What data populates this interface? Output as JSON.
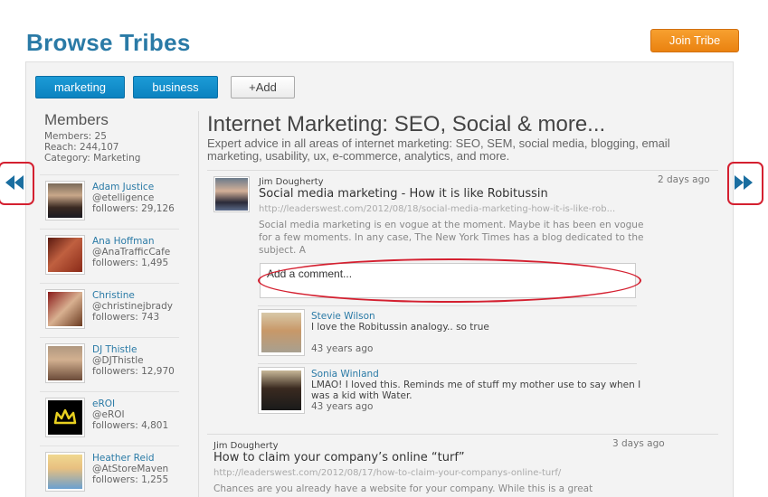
{
  "header": {
    "title": "Browse Tribes",
    "join_label": "Join Tribe"
  },
  "tags": [
    {
      "label": "marketing"
    },
    {
      "label": "business"
    }
  ],
  "add_label": "+Add",
  "members": {
    "title": "Members",
    "count": "Members: 25",
    "reach": "Reach: 244,107",
    "category": "Category: Marketing",
    "list": [
      {
        "name": "Adam Justice",
        "handle": "@etelligence",
        "followers": "followers: 29,126"
      },
      {
        "name": "Ana Hoffman",
        "handle": "@AnaTrafficCafe",
        "followers": "followers: 1,495"
      },
      {
        "name": "Christine",
        "handle": "@christinejbrady",
        "followers": "followers: 743"
      },
      {
        "name": "DJ Thistle",
        "handle": "@DJThistle",
        "followers": "followers: 12,970"
      },
      {
        "name": "eROI",
        "handle": "@eROI",
        "followers": "followers: 4,801"
      },
      {
        "name": "Heather Reid",
        "handle": "@AtStoreMaven",
        "followers": "followers: 1,255"
      }
    ]
  },
  "tribe": {
    "title": "Internet Marketing: SEO, Social & more...",
    "description": "Expert advice in all areas of internet marketing: SEO, SEM, social media, blogging, email marketing, usability, ux, e-commerce, analytics, and more."
  },
  "posts": [
    {
      "author": "Jim Dougherty",
      "time": "2 days ago",
      "title": "Social media marketing - How it is like Robitussin",
      "url": "http://leaderswest.com/2012/08/18/social-media-marketing-how-it-is-like-rob...",
      "excerpt": "Social media marketing is en vogue at the moment.  Maybe it has been en vogue for a few moments.  In any case, The New York Times has a blog dedicated to the subject. A",
      "comment_placeholder": "Add a comment...",
      "comments": [
        {
          "name": "Stevie Wilson",
          "text": "I love the Robitussin analogy.. so true",
          "time": "43 years ago"
        },
        {
          "name": "Sonia Winland",
          "text": "LMAO! I loved this. Reminds me of stuff my mother use to say when I was a kid with Water.",
          "time": "43 years ago"
        }
      ]
    },
    {
      "author": "Jim Dougherty",
      "time": "3 days ago",
      "title": "How to claim your company’s online “turf”",
      "url": "http://leaderswest.com/2012/08/17/how-to-claim-your-companys-online-turf/",
      "excerpt": "Chances are you already have a website for your company. While this is a great"
    }
  ],
  "colors": {
    "brand_blue": "#2a7aa6",
    "tag_blue": "#0b82c0",
    "join_orange": "#ea8210",
    "highlight_red": "#d42030"
  },
  "icons": {
    "prev": "rewind-icon",
    "next": "fast-forward-icon"
  }
}
